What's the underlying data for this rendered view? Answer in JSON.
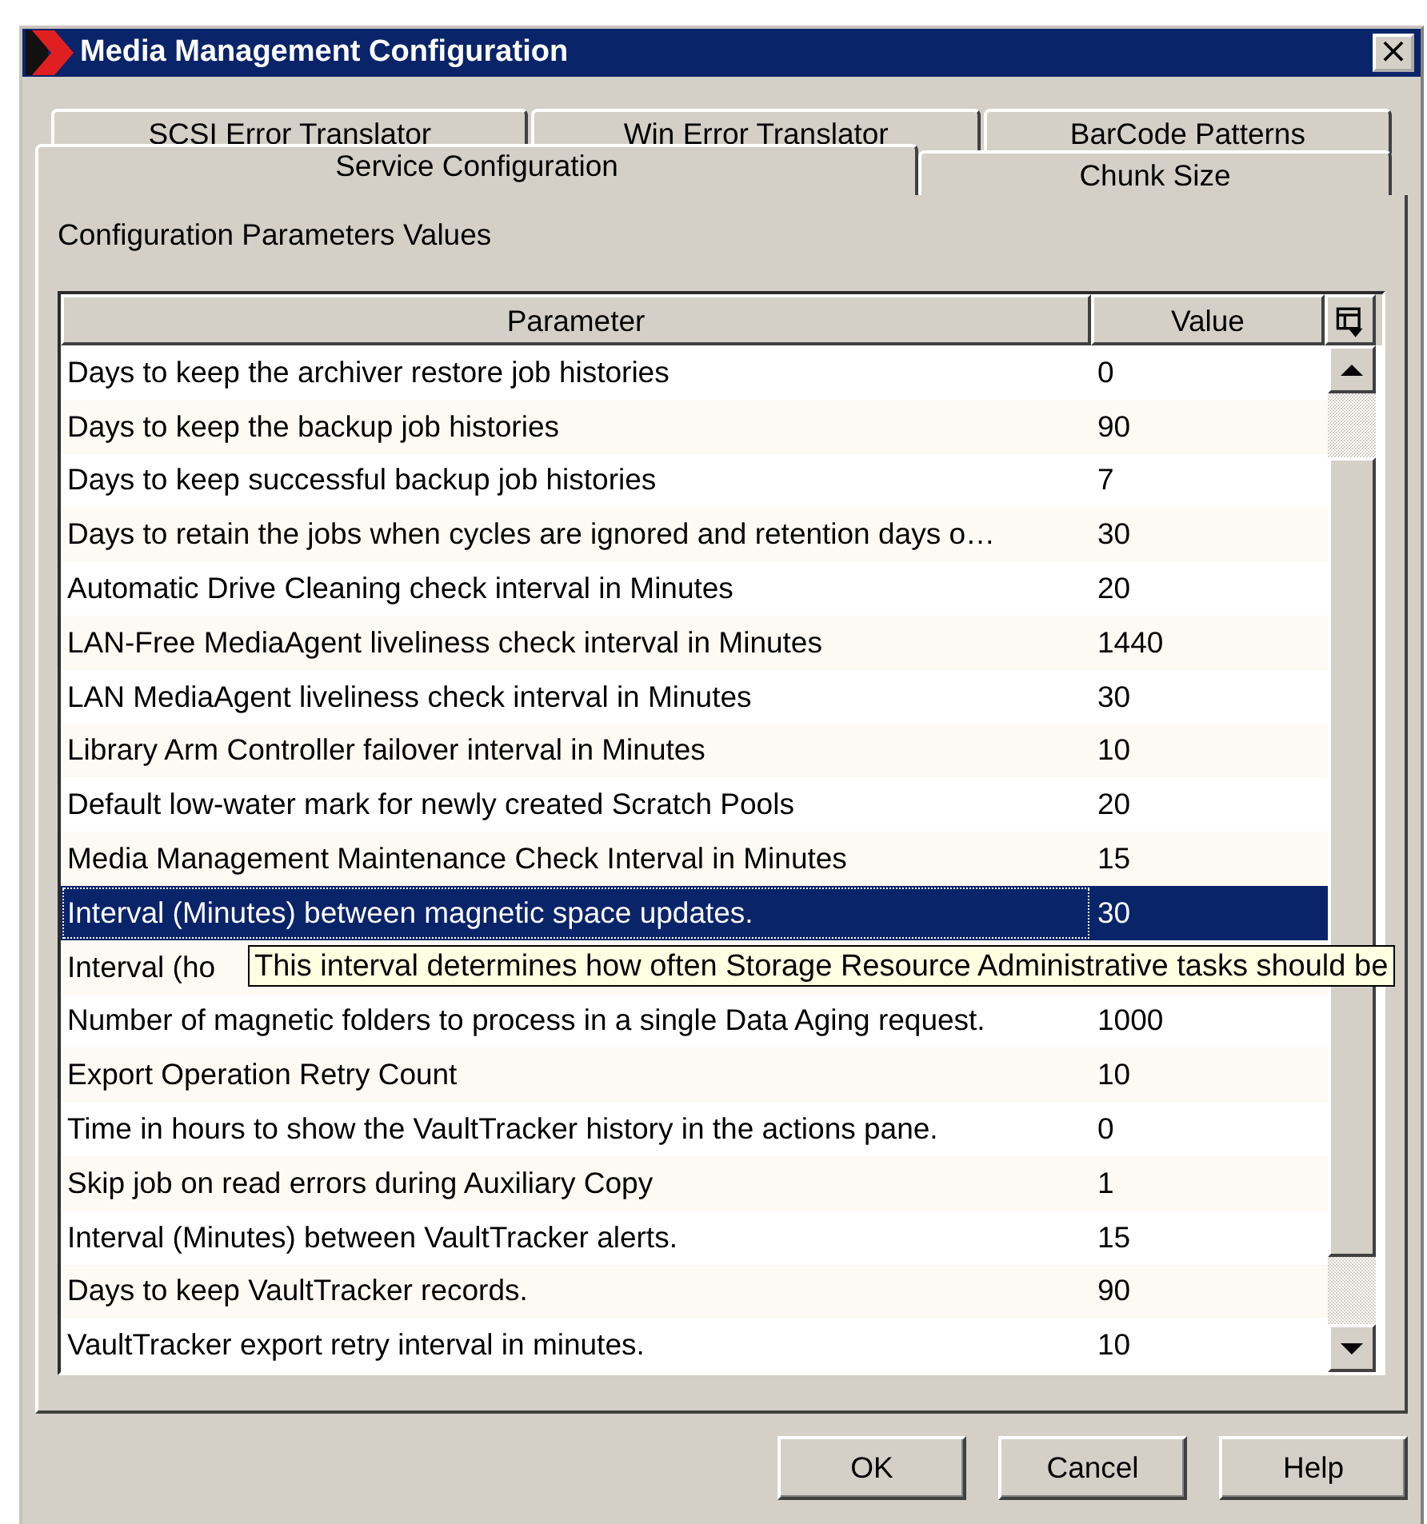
{
  "window": {
    "title": "Media Management Configuration",
    "close": "×"
  },
  "tabs": [
    {
      "label": "SCSI Error Translator",
      "selected": false
    },
    {
      "label": "Win Error Translator",
      "selected": false
    },
    {
      "label": "BarCode Patterns",
      "selected": false
    },
    {
      "label": "Service Configuration",
      "selected": true
    },
    {
      "label": "Chunk Size",
      "selected": false
    }
  ],
  "group_label": "Configuration Parameters Values",
  "table": {
    "columns": [
      "Parameter",
      "Value"
    ],
    "rows": [
      {
        "parameter": "Days to keep the archiver restore job histories",
        "value": "0",
        "selected": false
      },
      {
        "parameter": "Days to keep the backup job histories",
        "value": "90",
        "selected": false
      },
      {
        "parameter": "Days to keep successful backup job histories",
        "value": "7",
        "selected": false
      },
      {
        "parameter": "Days to retain the jobs when cycles are ignored and retention days o…",
        "value": "30",
        "selected": false
      },
      {
        "parameter": "Automatic Drive Cleaning check interval in Minutes",
        "value": "20",
        "selected": false
      },
      {
        "parameter": "LAN-Free MediaAgent liveliness check interval in Minutes",
        "value": "1440",
        "selected": false
      },
      {
        "parameter": "LAN MediaAgent liveliness check interval in Minutes",
        "value": "30",
        "selected": false
      },
      {
        "parameter": "Library Arm Controller failover interval in Minutes",
        "value": "10",
        "selected": false
      },
      {
        "parameter": "Default low-water mark for newly created Scratch Pools",
        "value": "20",
        "selected": false
      },
      {
        "parameter": "Media Management Maintenance Check Interval in Minutes",
        "value": "15",
        "selected": false
      },
      {
        "parameter": "Interval (Minutes) between magnetic space updates.",
        "value": "30",
        "selected": true
      },
      {
        "parameter": "Interval (ho",
        "selected": false,
        "tooltip": "This interval determines how often Storage Resource Administrative tasks should be"
      },
      {
        "parameter": "Number of magnetic folders to process in a single Data Aging request.",
        "value": "1000",
        "selected": false
      },
      {
        "parameter": "Export Operation Retry Count",
        "value": "10",
        "selected": false
      },
      {
        "parameter": "Time in hours to show the VaultTracker history in the actions pane.",
        "value": "0",
        "selected": false
      },
      {
        "parameter": "Skip job on read errors during Auxiliary Copy",
        "value": "1",
        "selected": false
      },
      {
        "parameter": "Interval (Minutes) between VaultTracker alerts.",
        "value": "15",
        "selected": false
      },
      {
        "parameter": "Days to keep VaultTracker records.",
        "value": "90",
        "selected": false
      },
      {
        "parameter": "VaultTracker export retry interval in minutes.",
        "value": "10",
        "selected": false
      }
    ]
  },
  "buttons": [
    "OK",
    "Cancel",
    "Help"
  ]
}
